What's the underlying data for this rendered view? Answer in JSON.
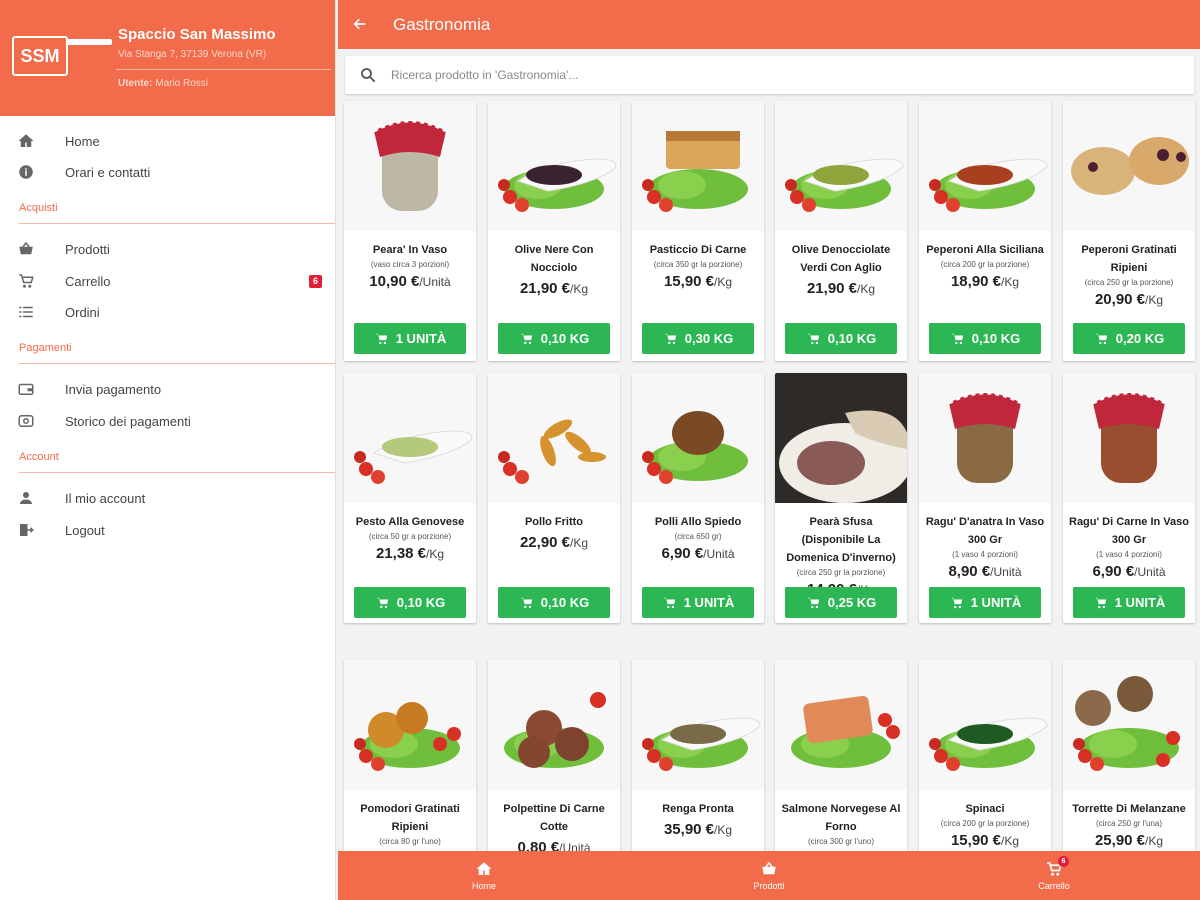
{
  "sidebar": {
    "logo_text": "SSM",
    "store_name": "Spaccio San Massimo",
    "store_address": "Via Stanga 7, 37139 Verona (VR)",
    "user_label": "Utente:",
    "user_name": "Mario Rossi",
    "items": [
      {
        "label": "Home",
        "icon": "home-icon"
      },
      {
        "label": "Orari e contatti",
        "icon": "info-icon"
      }
    ],
    "sections": [
      {
        "title": "Acquisti",
        "items": [
          {
            "label": "Prodotti",
            "icon": "basket-icon"
          },
          {
            "label": "Carrello",
            "icon": "cart-icon",
            "badge": "6"
          },
          {
            "label": "Ordini",
            "icon": "list-icon"
          }
        ]
      },
      {
        "title": "Pagamenti",
        "items": [
          {
            "label": "Invia pagamento",
            "icon": "wallet-icon"
          },
          {
            "label": "Storico dei pagamenti",
            "icon": "payment-history-icon"
          }
        ]
      },
      {
        "title": "Account",
        "items": [
          {
            "label": "Il mio account",
            "icon": "person-icon"
          },
          {
            "label": "Logout",
            "icon": "logout-icon"
          }
        ]
      }
    ]
  },
  "header": {
    "title": "Gastronomia"
  },
  "search": {
    "placeholder": "Ricerca prodotto in 'Gastronomia'..."
  },
  "products": [
    {
      "name": "Peara' In Vaso",
      "note": "(vaso circa 3 porzioni)",
      "price": "10,90 €",
      "unit": "/Unità",
      "button": "1 UNITÀ",
      "image": "jar"
    },
    {
      "name": "Olive Nere Con Nocciolo",
      "note": "",
      "price": "21,90 €",
      "unit": "/Kg",
      "button": "0,10 KG",
      "image": "spoon-dark"
    },
    {
      "name": "Pasticcio Di Carne",
      "note": "(circa 350 gr la porzione)",
      "price": "15,90 €",
      "unit": "/Kg",
      "button": "0,30 KG",
      "image": "lasagna"
    },
    {
      "name": "Olive Denocciolate Verdi Con Aglio",
      "note": "",
      "price": "21,90 €",
      "unit": "/Kg",
      "button": "0,10 KG",
      "image": "spoon-green"
    },
    {
      "name": "Peperoni Alla Siciliana",
      "note": "(circa 200 gr la porzione)",
      "price": "18,90 €",
      "unit": "/Kg",
      "button": "0,10 KG",
      "image": "spoon-red"
    },
    {
      "name": "Peperoni Gratinati Ripieni",
      "note": "(circa 250 gr la porzione)",
      "price": "20,90 €",
      "unit": "/Kg",
      "button": "0,20 KG",
      "image": "gratin"
    },
    {
      "name": "Pesto Alla Genovese",
      "note": "(circa 50 gr a porzione)",
      "price": "21,38 €",
      "unit": "/Kg",
      "button": "0,10 KG",
      "image": "spoon-pesto"
    },
    {
      "name": "Pollo Fritto",
      "note": "",
      "price": "22,90 €",
      "unit": "/Kg",
      "button": "0,10 KG",
      "image": "fried"
    },
    {
      "name": "Polli Allo Spiedo",
      "note": "(circa 650 gr)",
      "price": "6,90 €",
      "unit": "/Unità",
      "button": "1 UNITÀ",
      "image": "chicken"
    },
    {
      "name": "Pearà Sfusa (Disponibile La Domenica D'inverno)",
      "note": "(circa 250 gr la porzione)",
      "price": "14,90 €",
      "unit": "/Kg",
      "button": "0,25 KG",
      "image": "plate"
    },
    {
      "name": "Ragu' D'anatra In Vaso 300 Gr",
      "note": "(1 vaso 4 porzioni)",
      "price": "8,90 €",
      "unit": "/Unità",
      "button": "1 UNITÀ",
      "image": "jar-brown"
    },
    {
      "name": "Ragu' Di Carne In Vaso 300 Gr",
      "note": "(1 vaso 4 porzioni)",
      "price": "6,90 €",
      "unit": "/Unità",
      "button": "1 UNITÀ",
      "image": "jar-red"
    },
    {
      "name": "Pomodori Gratinati Ripieni",
      "note": "(circa 80 gr l'uno)",
      "price": "",
      "unit": "",
      "button": "",
      "image": "balls"
    },
    {
      "name": "Polpettine Di Carne Cotte",
      "note": "",
      "price": "0,80 €",
      "unit": "/Unità",
      "button": "",
      "image": "meatballs"
    },
    {
      "name": "Renga Pronta",
      "note": "",
      "price": "35,90 €",
      "unit": "/Kg",
      "button": "",
      "image": "spoon-lentil"
    },
    {
      "name": "Salmone Norvegese Al Forno",
      "note": "(circa 300 gr l'uno)",
      "price": "",
      "unit": "",
      "button": "",
      "image": "salmon"
    },
    {
      "name": "Spinaci",
      "note": "(circa 200 gr la porzione)",
      "price": "15,90 €",
      "unit": "/Kg",
      "button": "",
      "image": "spoon-spinach"
    },
    {
      "name": "Torrette Di Melanzane",
      "note": "(circa 250 gr l'una)",
      "price": "25,90 €",
      "unit": "/Kg",
      "button": "",
      "image": "eggplant"
    }
  ],
  "bottom_nav": [
    {
      "label": "Home",
      "icon": "home-icon"
    },
    {
      "label": "Prodotti",
      "icon": "basket-icon"
    },
    {
      "label": "Carrello",
      "icon": "cart-icon",
      "badge": "6"
    }
  ],
  "colors": {
    "brand": "#f26b4a",
    "button": "#2db754",
    "badge": "#e0203a"
  }
}
